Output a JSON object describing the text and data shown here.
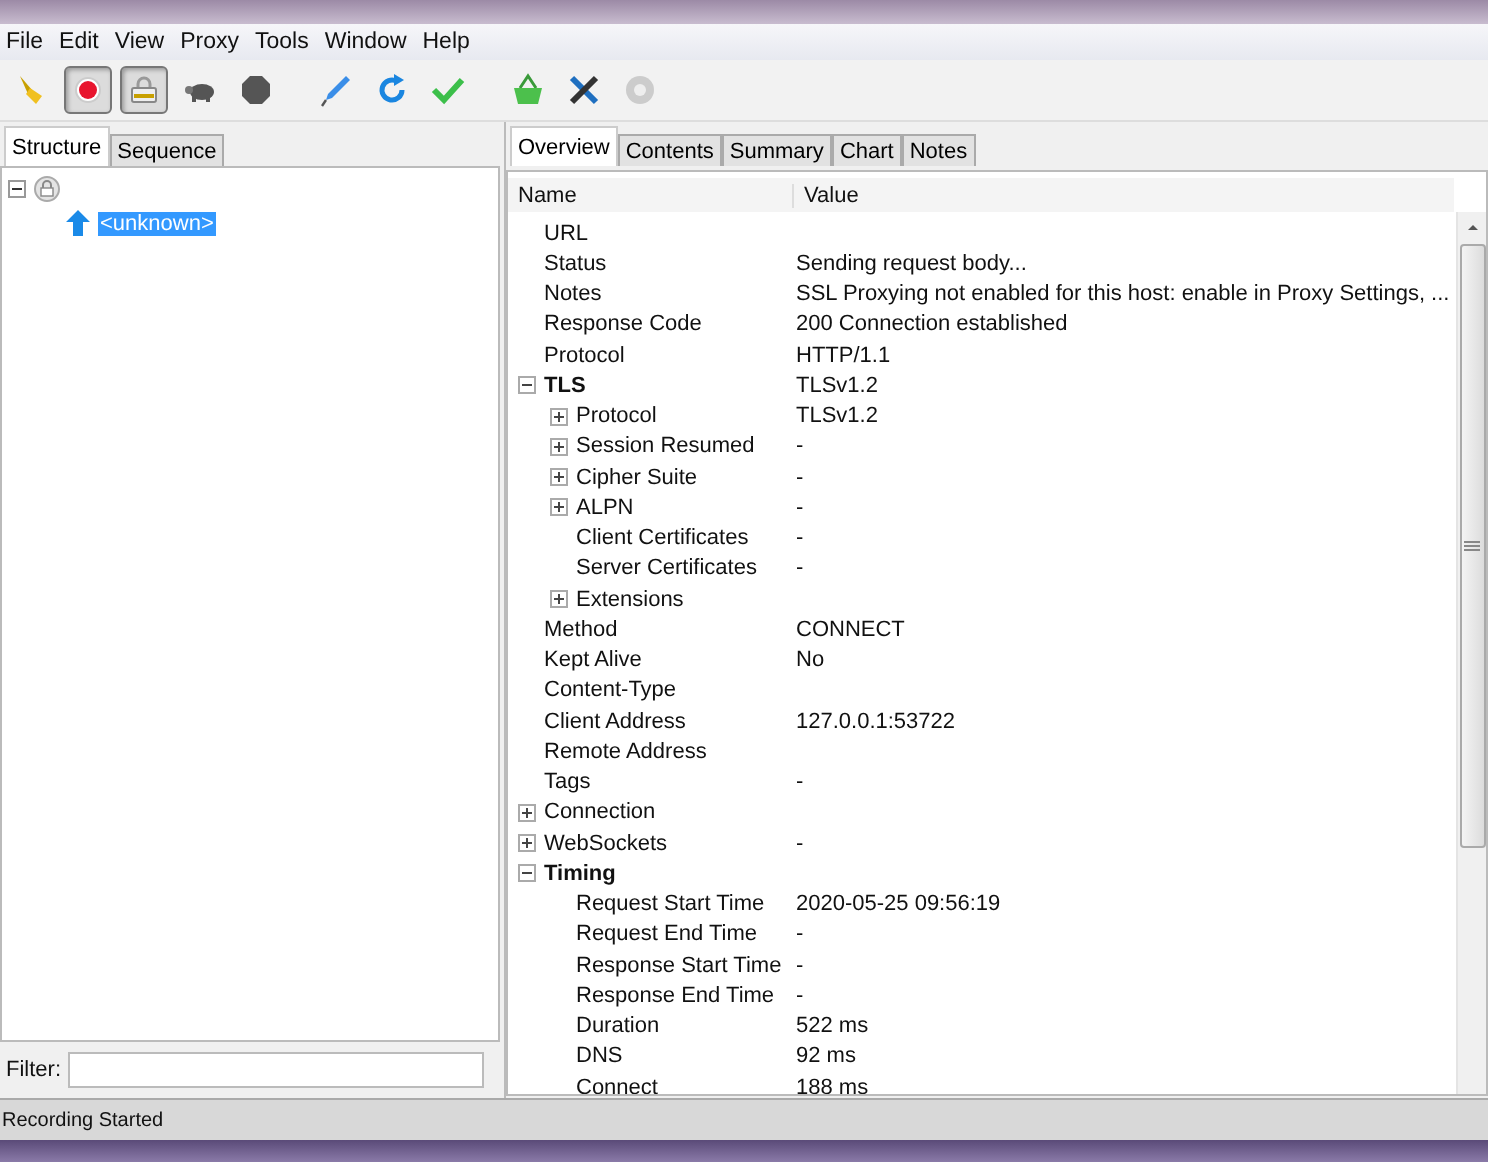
{
  "menu": [
    "File",
    "Edit",
    "View",
    "Proxy",
    "Tools",
    "Window",
    "Help"
  ],
  "toolbar": [
    {
      "pressed": false
    },
    {
      "pressed": true
    },
    {
      "pressed": true
    },
    {
      "pressed": false
    },
    {
      "pressed": false
    },
    {
      "pressed": false
    },
    {
      "pressed": false
    },
    {
      "pressed": false
    },
    {
      "pressed": false
    },
    {
      "pressed": false
    },
    {
      "pressed": false
    }
  ],
  "left_tabs": [
    {
      "label": "Structure",
      "selected": true
    },
    {
      "label": "Sequence",
      "selected": false
    }
  ],
  "structure_tree": [
    {
      "expanded": true,
      "children": [
        {
          "label": "<unknown>",
          "selected": true
        }
      ]
    }
  ],
  "filter": {
    "label": "Filter:"
  },
  "right_tabs": [
    {
      "label": "Overview",
      "selected": true
    },
    {
      "label": "Contents",
      "selected": false
    },
    {
      "label": "Summary",
      "selected": false
    },
    {
      "label": "Chart",
      "selected": false
    },
    {
      "label": "Notes",
      "selected": false
    }
  ],
  "columns": [
    "Name",
    "Value"
  ],
  "rows": [
    {
      "name": "URL"
    },
    {
      "name": "Status",
      "value": "Sending request body..."
    },
    {
      "name": "Notes",
      "value": "SSL Proxying not enabled for this host: enable in Proxy Settings, ..."
    },
    {
      "name": "Response Code",
      "value": "200 Connection established"
    },
    {
      "name": "Protocol",
      "value": "HTTP/1.1"
    },
    {
      "name": "TLS",
      "value": "TLSv1.2",
      "expanded": true,
      "children": [
        {
          "name": "Protocol",
          "value": "TLSv1.2",
          "expanded": false
        },
        {
          "name": "Session Resumed",
          "value": "-",
          "expanded": false
        },
        {
          "name": "Cipher Suite",
          "value": "-",
          "expanded": false
        },
        {
          "name": "ALPN",
          "value": "-",
          "expanded": false
        },
        {
          "name": "Client Certificates",
          "value": "-"
        },
        {
          "name": "Server Certificates",
          "value": "-"
        },
        {
          "name": "Extensions",
          "expanded": false
        }
      ]
    },
    {
      "name": "Method",
      "value": "CONNECT"
    },
    {
      "name": "Kept Alive",
      "value": "No"
    },
    {
      "name": "Content-Type"
    },
    {
      "name": "Client Address",
      "value": "127.0.0.1:53722"
    },
    {
      "name": "Remote Address"
    },
    {
      "name": "Tags",
      "value": "-"
    },
    {
      "name": "Connection",
      "expanded": false
    },
    {
      "name": "WebSockets",
      "value": "-",
      "expanded": false
    },
    {
      "name": "Timing",
      "expanded": true,
      "children": [
        {
          "name": "Request Start Time",
          "value": "2020-05-25 09:56:19"
        },
        {
          "name": "Request End Time",
          "value": "-"
        },
        {
          "name": "Response Start Time",
          "value": "-"
        },
        {
          "name": "Response End Time",
          "value": "-"
        },
        {
          "name": "Duration",
          "value": "522 ms"
        },
        {
          "name": "DNS",
          "value": "92 ms"
        },
        {
          "name": "Connect",
          "value": "188 ms"
        }
      ]
    }
  ],
  "status_bar": {
    "text": "Recording Started"
  }
}
